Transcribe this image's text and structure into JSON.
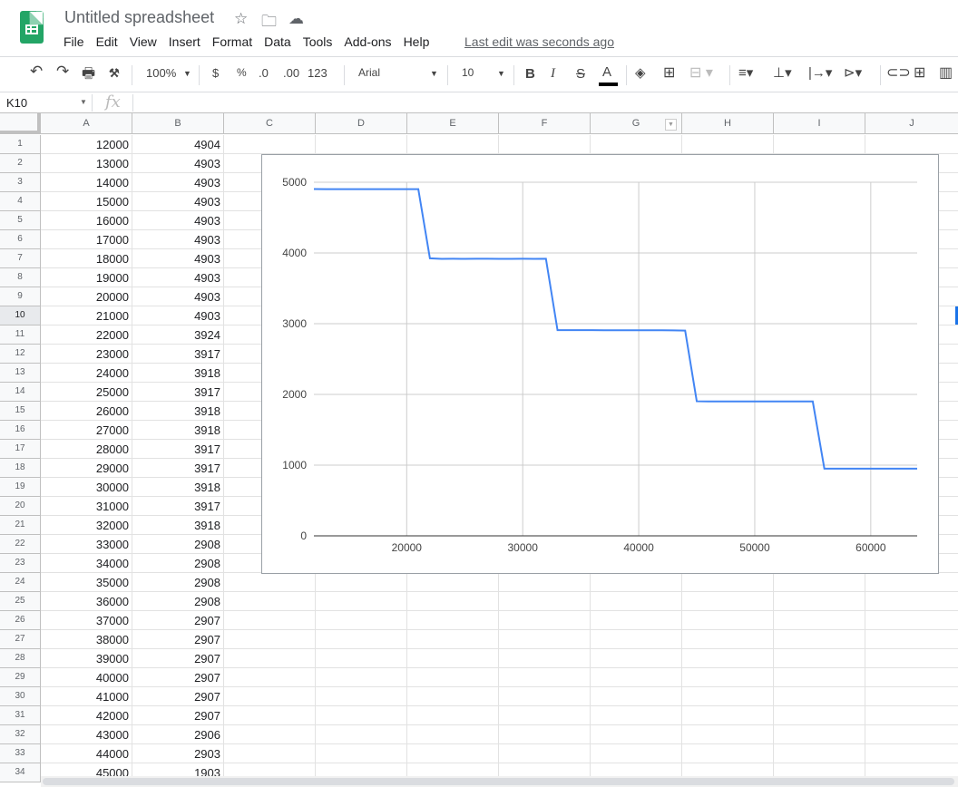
{
  "header": {
    "title": "Untitled spreadsheet",
    "last_edit": "Last edit was seconds ago",
    "menu": [
      "File",
      "Edit",
      "View",
      "Insert",
      "Format",
      "Data",
      "Tools",
      "Add-ons",
      "Help"
    ]
  },
  "toolbar": {
    "zoom": "100%",
    "currency": "$",
    "percent": "%",
    "dec_decrease": ".0",
    "dec_increase": ".00",
    "more_formats": "123",
    "font": "Arial",
    "font_size": "10",
    "bold": "B",
    "italic": "I",
    "strike": "S",
    "text_color": "A",
    "text_color_value": "#000000"
  },
  "formula_bar": {
    "name_box": "K10",
    "fx": "fx",
    "value": ""
  },
  "columns": [
    "A",
    "B",
    "C",
    "D",
    "E",
    "F",
    "G",
    "H",
    "I",
    "J"
  ],
  "rows": [
    [
      12000,
      4904
    ],
    [
      13000,
      4903
    ],
    [
      14000,
      4903
    ],
    [
      15000,
      4903
    ],
    [
      16000,
      4903
    ],
    [
      17000,
      4903
    ],
    [
      18000,
      4903
    ],
    [
      19000,
      4903
    ],
    [
      20000,
      4903
    ],
    [
      21000,
      4903
    ],
    [
      22000,
      3924
    ],
    [
      23000,
      3917
    ],
    [
      24000,
      3918
    ],
    [
      25000,
      3917
    ],
    [
      26000,
      3918
    ],
    [
      27000,
      3918
    ],
    [
      28000,
      3917
    ],
    [
      29000,
      3917
    ],
    [
      30000,
      3918
    ],
    [
      31000,
      3917
    ],
    [
      32000,
      3918
    ],
    [
      33000,
      2908
    ],
    [
      34000,
      2908
    ],
    [
      35000,
      2908
    ],
    [
      36000,
      2908
    ],
    [
      37000,
      2907
    ],
    [
      38000,
      2907
    ],
    [
      39000,
      2907
    ],
    [
      40000,
      2907
    ],
    [
      41000,
      2907
    ],
    [
      42000,
      2907
    ],
    [
      43000,
      2906
    ],
    [
      44000,
      2903
    ],
    [
      45000,
      1903
    ]
  ],
  "selected_row": 10,
  "chart_data": {
    "type": "line",
    "title": "",
    "xlabel": "",
    "ylabel": "",
    "xlim": [
      12000,
      64000
    ],
    "ylim": [
      0,
      5000
    ],
    "grid": true,
    "legend": "none",
    "color": "#4285f4",
    "xticks": [
      20000,
      30000,
      40000,
      50000,
      60000
    ],
    "yticks": [
      0,
      1000,
      2000,
      3000,
      4000,
      5000
    ],
    "x": [
      12000,
      13000,
      14000,
      15000,
      16000,
      17000,
      18000,
      19000,
      20000,
      21000,
      22000,
      23000,
      24000,
      25000,
      26000,
      27000,
      28000,
      29000,
      30000,
      31000,
      32000,
      33000,
      34000,
      35000,
      36000,
      37000,
      38000,
      39000,
      40000,
      41000,
      42000,
      43000,
      44000,
      45000,
      46000,
      47000,
      48000,
      49000,
      50000,
      51000,
      52000,
      53000,
      54000,
      55000,
      56000,
      57000,
      58000,
      59000,
      60000,
      61000,
      62000,
      63000,
      64000
    ],
    "y": [
      4904,
      4903,
      4903,
      4903,
      4903,
      4903,
      4903,
      4903,
      4903,
      4903,
      3924,
      3917,
      3918,
      3917,
      3918,
      3918,
      3917,
      3917,
      3918,
      3917,
      3918,
      2908,
      2908,
      2908,
      2908,
      2907,
      2907,
      2907,
      2907,
      2907,
      2907,
      2906,
      2903,
      1903,
      1900,
      1900,
      1900,
      1900,
      1900,
      1900,
      1900,
      1900,
      1900,
      1900,
      950,
      950,
      950,
      950,
      950,
      950,
      950,
      950,
      950
    ]
  }
}
